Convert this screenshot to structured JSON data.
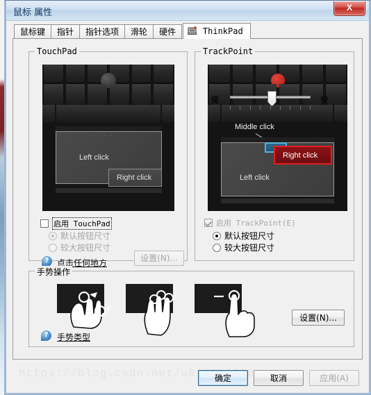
{
  "window": {
    "title": "鼠标 属性",
    "close_label": "X"
  },
  "tabs": [
    {
      "label": "鼠标键",
      "active": false
    },
    {
      "label": "指针",
      "active": false
    },
    {
      "label": "指针选项",
      "active": false
    },
    {
      "label": "滑轮",
      "active": false
    },
    {
      "label": "硬件",
      "active": false
    },
    {
      "label": "ThinkPad",
      "active": true,
      "icon": "thinkpad-device-icon"
    }
  ],
  "touchpad": {
    "legend": "TouchPad",
    "image": {
      "left_click_label": "Left click",
      "right_click_label": "Right click",
      "nub_color": "#3a3a3a",
      "surface_color": "#434343"
    },
    "enable_checkbox": {
      "label": "启用 TouchPad",
      "checked": false,
      "focused": true
    },
    "radios": [
      {
        "label": "默认按钮尺寸",
        "selected": true,
        "disabled": true
      },
      {
        "label": "较大按钮尺寸",
        "selected": false,
        "disabled": true
      }
    ],
    "help_link": "点击任何地方",
    "settings_button": {
      "label": "设置(N)...",
      "disabled": true
    }
  },
  "trackpoint": {
    "legend": "TrackPoint",
    "image": {
      "middle_click_label": "Middle click",
      "right_click_label": "Right click",
      "left_click_label": "Left click",
      "nub_color": "#c22a22",
      "middle_button_color": "#2c6a8c",
      "right_button_color": "#8c1216"
    },
    "enable_checkbox": {
      "label": "启用 TrackPoint(E)",
      "checked": true,
      "disabled": true
    },
    "radios": [
      {
        "label": "默认按钮尺寸",
        "selected": true,
        "disabled": false
      },
      {
        "label": "较大按钮尺寸",
        "selected": false,
        "disabled": false
      }
    ],
    "slider": {
      "min_label": "慢",
      "max_label": "快",
      "value_percent": 50,
      "tick_count": 9
    }
  },
  "gesture": {
    "legend": "手势操作",
    "tiles": [
      {
        "name": "pinch-zoom-gesture-icon"
      },
      {
        "name": "three-finger-swipe-gesture-icon"
      },
      {
        "name": "one-finger-swipe-left-gesture-icon"
      }
    ],
    "help_link": "手势类型",
    "settings_button": {
      "label": "设置(N)...",
      "disabled": false
    }
  },
  "footer": {
    "ok_label": "确定",
    "cancel_label": "取消",
    "apply_label": "应用(A)",
    "watermark": "https://blog.csdn.net/u010298818"
  }
}
